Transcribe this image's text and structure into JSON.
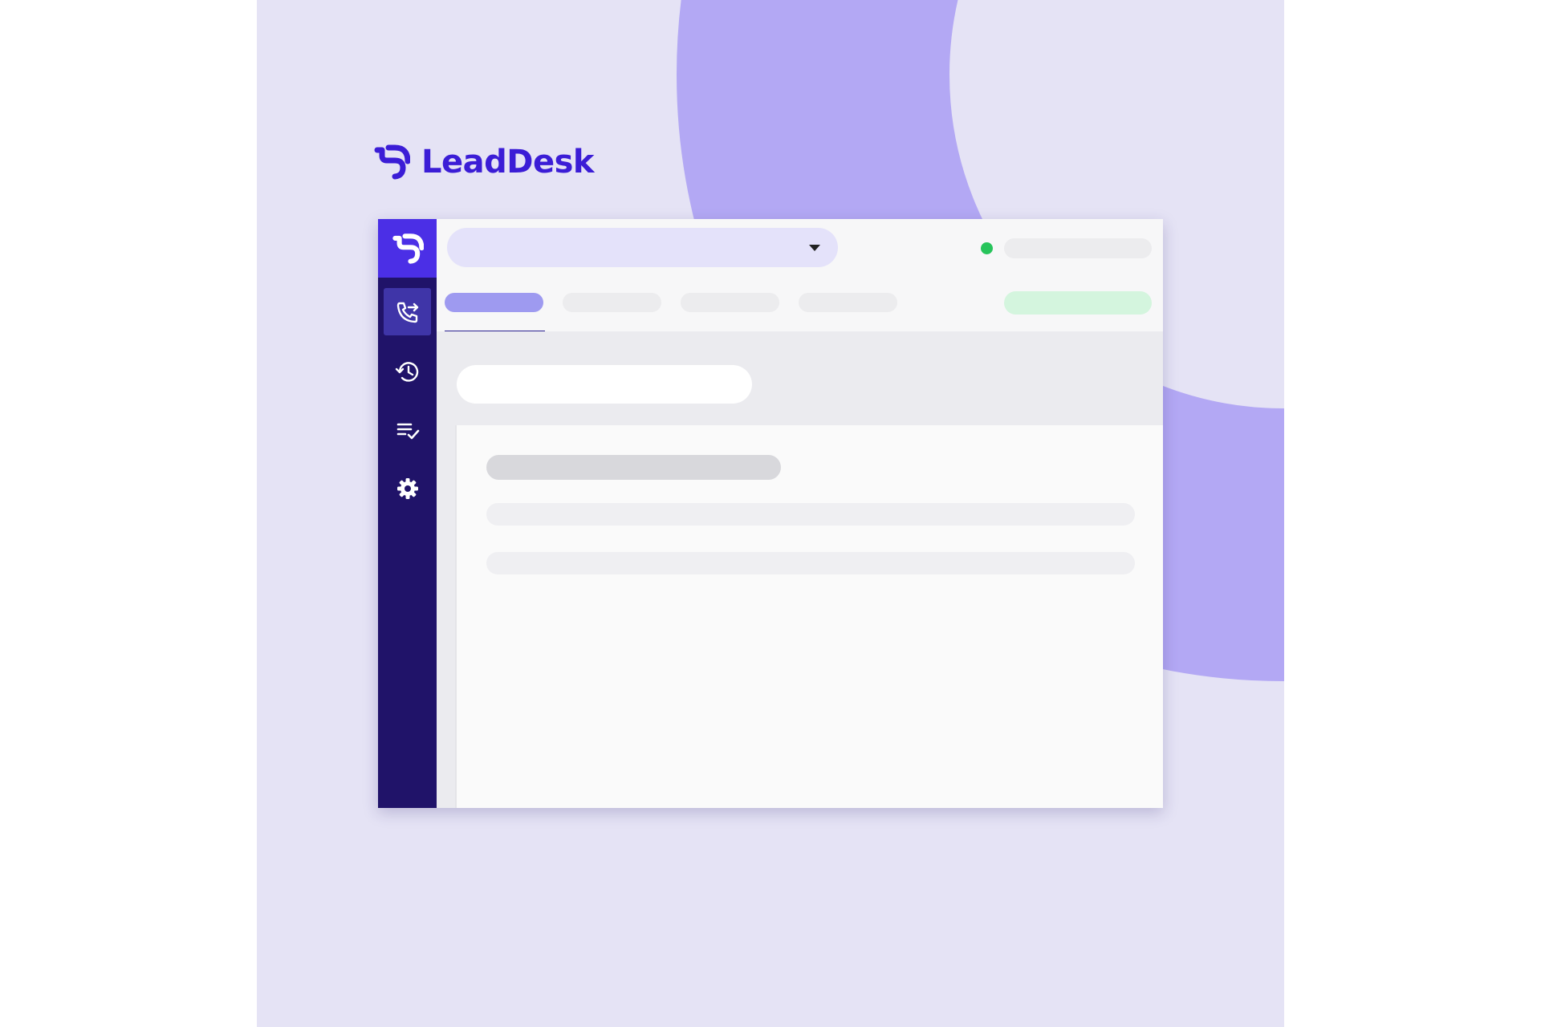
{
  "brand": {
    "name": "LeadDesk",
    "logo_icon": "leaddesk-logo-icon"
  },
  "colors": {
    "background": "#e5e3f5",
    "decoration": "#b3a8f4",
    "brand_text": "#3b1dd6",
    "sidebar": "#201369",
    "sidebar_logo": "#4b2fe6",
    "sidebar_active": "#3f35a8",
    "status_online": "#27c45b",
    "action_button": "#d4f5de",
    "active_tab": "#9e9af0"
  },
  "sidebar": {
    "logo_icon": "leaddesk-logo-icon",
    "items": [
      {
        "icon": "phone-transfer-icon",
        "active": true
      },
      {
        "icon": "history-icon",
        "active": false
      },
      {
        "icon": "checklist-icon",
        "active": false
      },
      {
        "icon": "gear-icon",
        "active": false
      }
    ]
  },
  "topbar": {
    "selector_icon": "chevron-down-icon",
    "status": "online",
    "tabs": [
      {
        "active": true
      },
      {
        "active": false
      },
      {
        "active": false
      },
      {
        "active": false
      }
    ]
  }
}
